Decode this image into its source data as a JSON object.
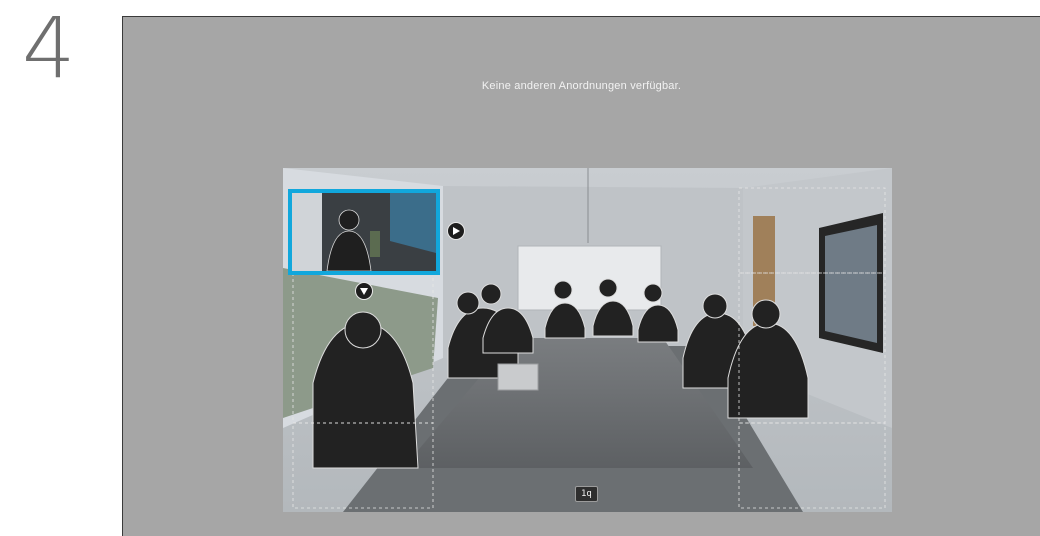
{
  "step": {
    "number": "4"
  },
  "panel": {
    "message": "Keine anderen Anordnungen verfügbar."
  },
  "pip": {
    "move_right_icon": "play-right-icon",
    "move_down_icon": "play-down-icon"
  },
  "layout_badge": {
    "label": "1q"
  },
  "colors": {
    "panel_background": "#a6a6a6",
    "pip_border": "#11a7dc",
    "step_number": "#6f6f6f"
  }
}
